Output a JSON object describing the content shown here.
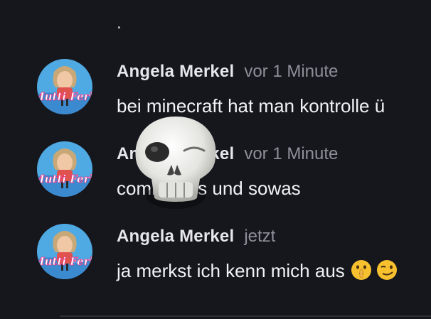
{
  "chat": {
    "top_fragment": ".",
    "messages": [
      {
        "author": "Angela Merkel",
        "time": "vor 1 Minute",
        "text": "bei minecraft hat man kontrolle ü",
        "avatar_caption": "Mutti Ferk"
      },
      {
        "author": "Angela Merkel",
        "time": "vor 1 Minute",
        "text": "commands und sowas",
        "avatar_caption": "Mutti Ferk"
      },
      {
        "author": "Angela Merkel",
        "time": "jetzt",
        "text": "ja merkst ich kenn mich aus",
        "avatar_caption": "Mutti Ferk",
        "emojis": [
          "shushing-face-icon",
          "smirk-face-icon"
        ]
      }
    ]
  },
  "reaction": {
    "icon": "skull-icon"
  },
  "colors": {
    "background": "#16171d",
    "author": "#e6e6ec",
    "timestamp": "#8e8f99",
    "message_text": "#f2f2f6",
    "avatar_bg": "#4fa9e3"
  }
}
